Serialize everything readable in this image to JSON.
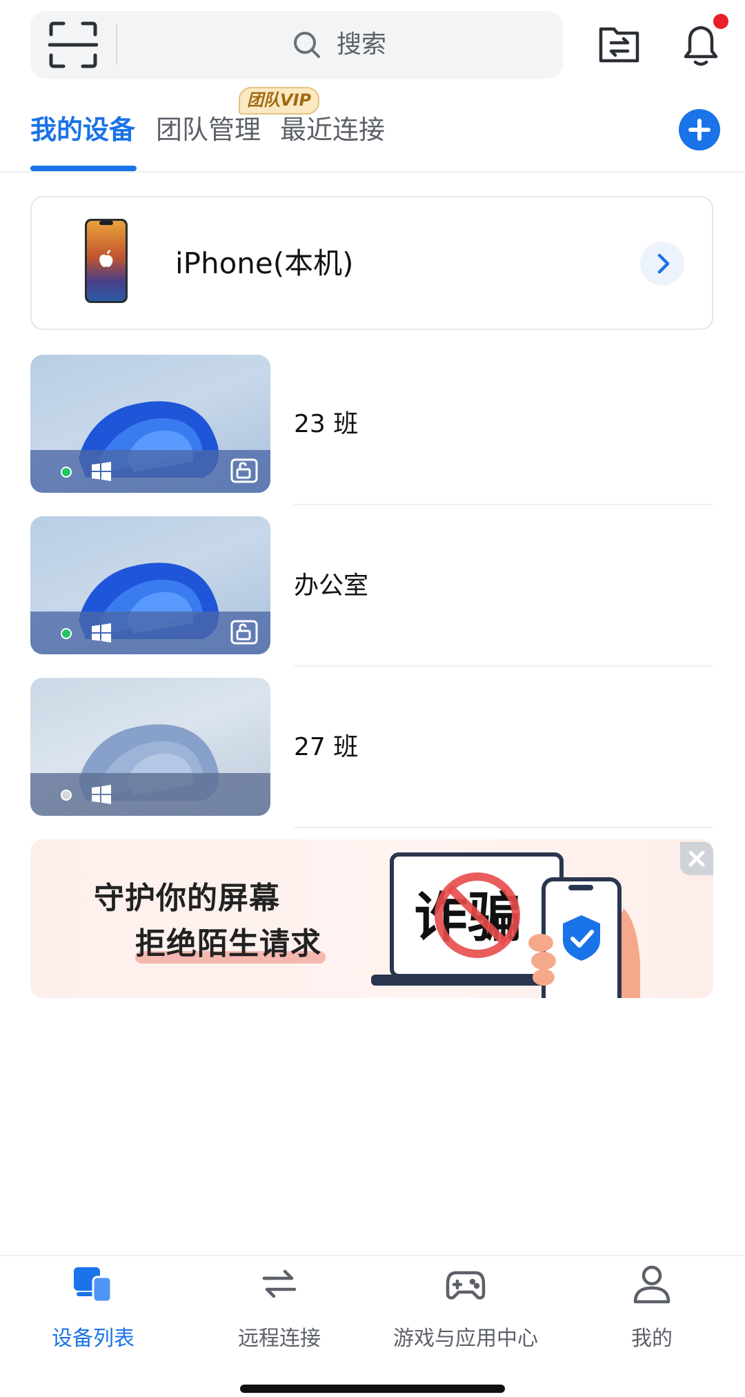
{
  "search": {
    "placeholder": "搜索"
  },
  "tabs": [
    {
      "label": "我的设备",
      "active": true
    },
    {
      "label": "团队管理",
      "active": false
    },
    {
      "label": "最近连接",
      "active": false
    }
  ],
  "vip_badge": "团队VIP",
  "this_device": {
    "name": "iPhone(本机)"
  },
  "devices": [
    {
      "name": "23 班",
      "online": true,
      "os": "windows-icon"
    },
    {
      "name": "办公室",
      "online": true,
      "os": "windows-icon"
    },
    {
      "name": "27 班",
      "online": false,
      "os": "windows-icon"
    }
  ],
  "banner": {
    "line1": "守护你的屏幕",
    "line2": "拒绝陌生请求",
    "stamp": "诈骗"
  },
  "bottom_nav": [
    {
      "label": "设备列表",
      "active": true
    },
    {
      "label": "远程连接",
      "active": false
    },
    {
      "label": "游戏与应用中心",
      "active": false
    },
    {
      "label": "我的",
      "active": false
    }
  ],
  "colors": {
    "accent": "#1a73e8",
    "online": "#22c55e",
    "offline": "#c7cbd1",
    "notify": "#e8202a"
  }
}
